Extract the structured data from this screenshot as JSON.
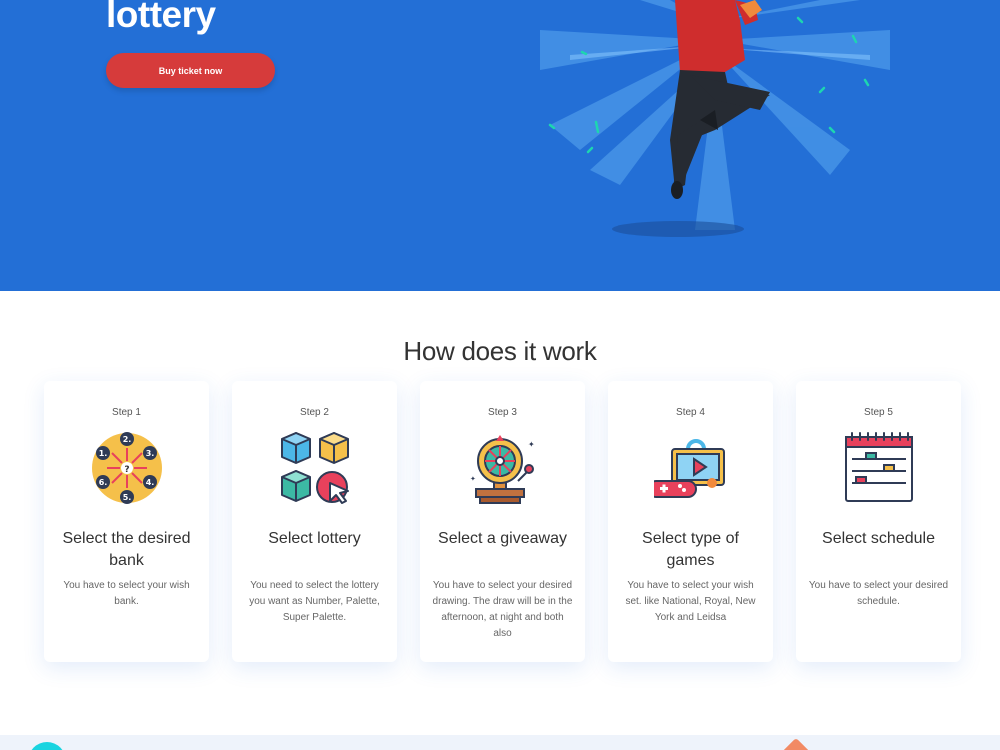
{
  "hero": {
    "title": "lottery",
    "button": "Buy ticket now",
    "bg_color": "#236fd6",
    "button_color": "#d63b3b"
  },
  "section": {
    "title": "How does it work"
  },
  "steps": [
    {
      "step": "Step 1",
      "title": "Select the desired bank",
      "desc": "You have to select your wish bank.",
      "icon": "wheel-numbers-icon"
    },
    {
      "step": "Step 2",
      "title": "Select lottery",
      "desc": "You need to select the lottery you want as Number, Palette, Super Palette.",
      "icon": "cubes-cursor-icon"
    },
    {
      "step": "Step 3",
      "title": "Select a giveaway",
      "desc": "You have to select your desired drawing. The draw will be in the afternoon, at night and both also",
      "icon": "fortune-wheel-icon"
    },
    {
      "step": "Step 4",
      "title": "Select type of games",
      "desc": "You have to select your wish set. like National, Royal, New York and Leidsa",
      "icon": "gamepad-screen-icon"
    },
    {
      "step": "Step 5",
      "title": "Select schedule",
      "desc": "You have to select your desired schedule.",
      "icon": "calendar-schedule-icon"
    }
  ]
}
